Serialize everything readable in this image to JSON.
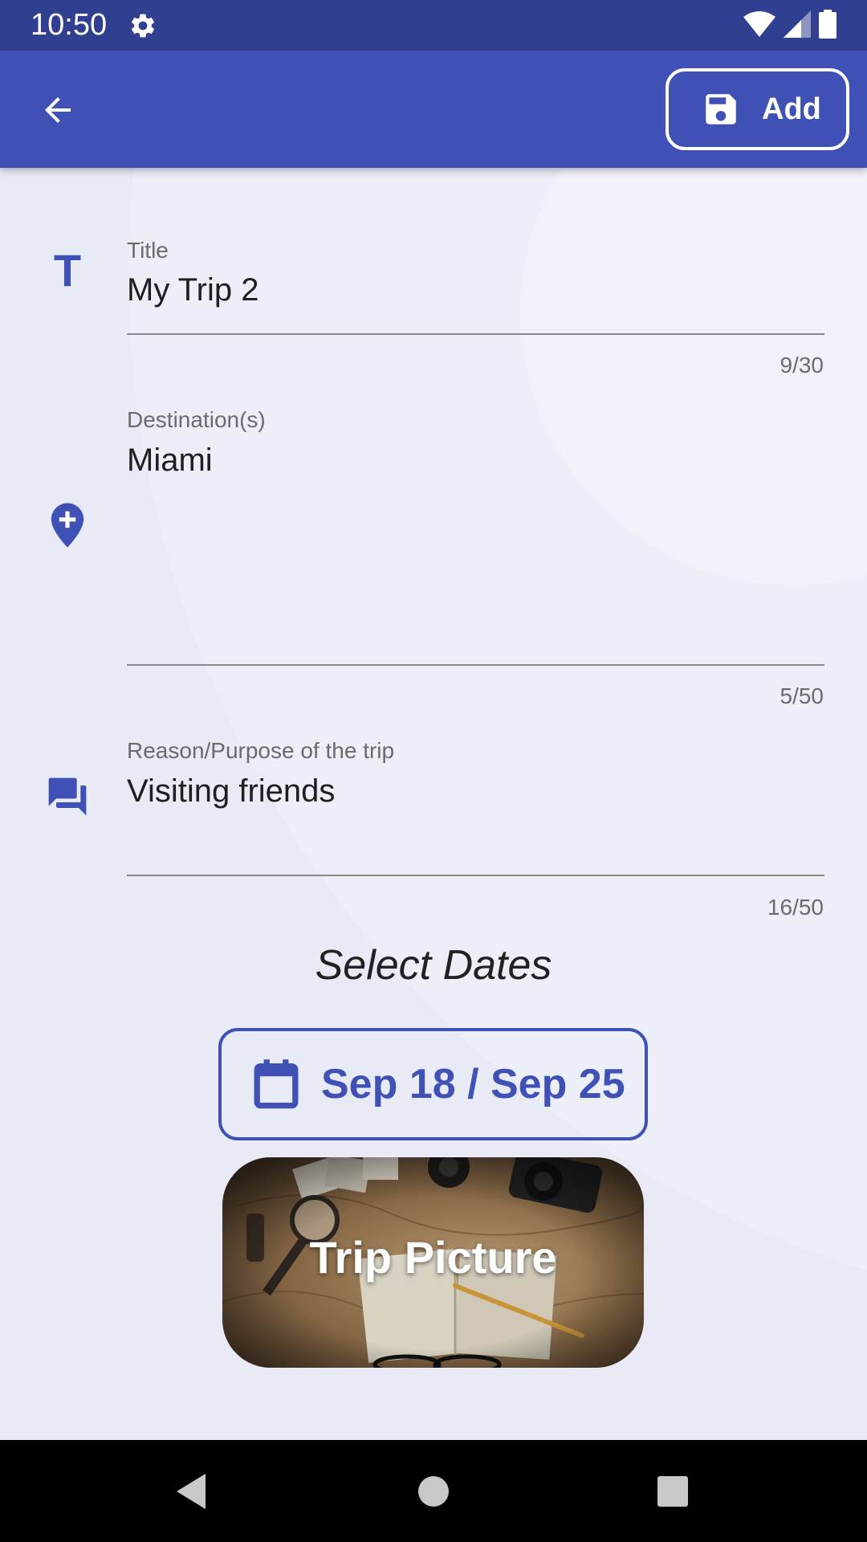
{
  "status_bar": {
    "time": "10:50"
  },
  "app_bar": {
    "add_label": "Add"
  },
  "form": {
    "title": {
      "label": "Title",
      "value": "My Trip 2",
      "counter": "9/30"
    },
    "destination": {
      "label": "Destination(s)",
      "value": "Miami",
      "counter": "5/50"
    },
    "reason": {
      "label": "Reason/Purpose of the trip",
      "value": "Visiting friends",
      "counter": "16/50"
    }
  },
  "dates": {
    "heading": "Select Dates",
    "range_label": "Sep 18 / Sep 25"
  },
  "picture": {
    "label": "Trip Picture"
  },
  "colors": {
    "primary": "#3f51b5",
    "primary_dark": "#303f8f",
    "background": "#e8eaf6"
  }
}
